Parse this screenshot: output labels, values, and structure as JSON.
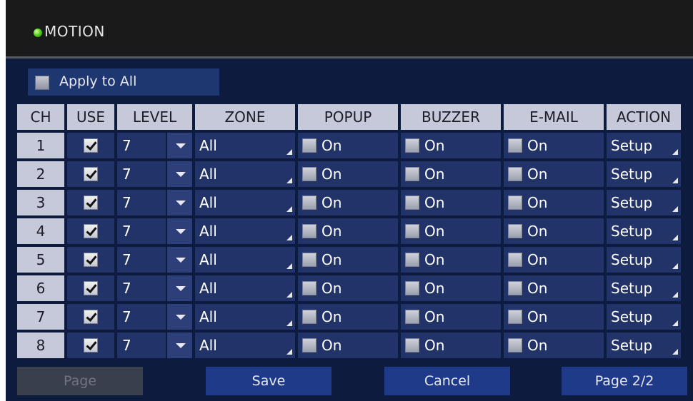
{
  "window": {
    "title": "MOTION"
  },
  "apply_to_all": {
    "label": "Apply to All",
    "checked": false
  },
  "table": {
    "headers": [
      "CH",
      "USE",
      "LEVEL",
      "ZONE",
      "POPUP",
      "BUZZER",
      "E-MAIL",
      "ACTION"
    ],
    "rows": [
      {
        "ch": "1",
        "use": true,
        "level": "7",
        "zone": "All",
        "popup": "On",
        "buzzer": "On",
        "email": "On",
        "action": "Setup"
      },
      {
        "ch": "2",
        "use": true,
        "level": "7",
        "zone": "All",
        "popup": "On",
        "buzzer": "On",
        "email": "On",
        "action": "Setup"
      },
      {
        "ch": "3",
        "use": true,
        "level": "7",
        "zone": "All",
        "popup": "On",
        "buzzer": "On",
        "email": "On",
        "action": "Setup"
      },
      {
        "ch": "4",
        "use": true,
        "level": "7",
        "zone": "All",
        "popup": "On",
        "buzzer": "On",
        "email": "On",
        "action": "Setup"
      },
      {
        "ch": "5",
        "use": true,
        "level": "7",
        "zone": "All",
        "popup": "On",
        "buzzer": "On",
        "email": "On",
        "action": "Setup"
      },
      {
        "ch": "6",
        "use": true,
        "level": "7",
        "zone": "All",
        "popup": "On",
        "buzzer": "On",
        "email": "On",
        "action": "Setup"
      },
      {
        "ch": "7",
        "use": true,
        "level": "7",
        "zone": "All",
        "popup": "On",
        "buzzer": "On",
        "email": "On",
        "action": "Setup"
      },
      {
        "ch": "8",
        "use": true,
        "level": "7",
        "zone": "All",
        "popup": "On",
        "buzzer": "On",
        "email": "On",
        "action": "Setup"
      }
    ]
  },
  "buttons": {
    "page_prev": "Page",
    "save": "Save",
    "cancel": "Cancel",
    "page_next": "Page 2/2"
  },
  "colors": {
    "status_led": "#5ad21f",
    "background": "#0c1b3e",
    "cell": "#22336a",
    "header": "#c5c9d9",
    "button": "#1f3a88"
  }
}
